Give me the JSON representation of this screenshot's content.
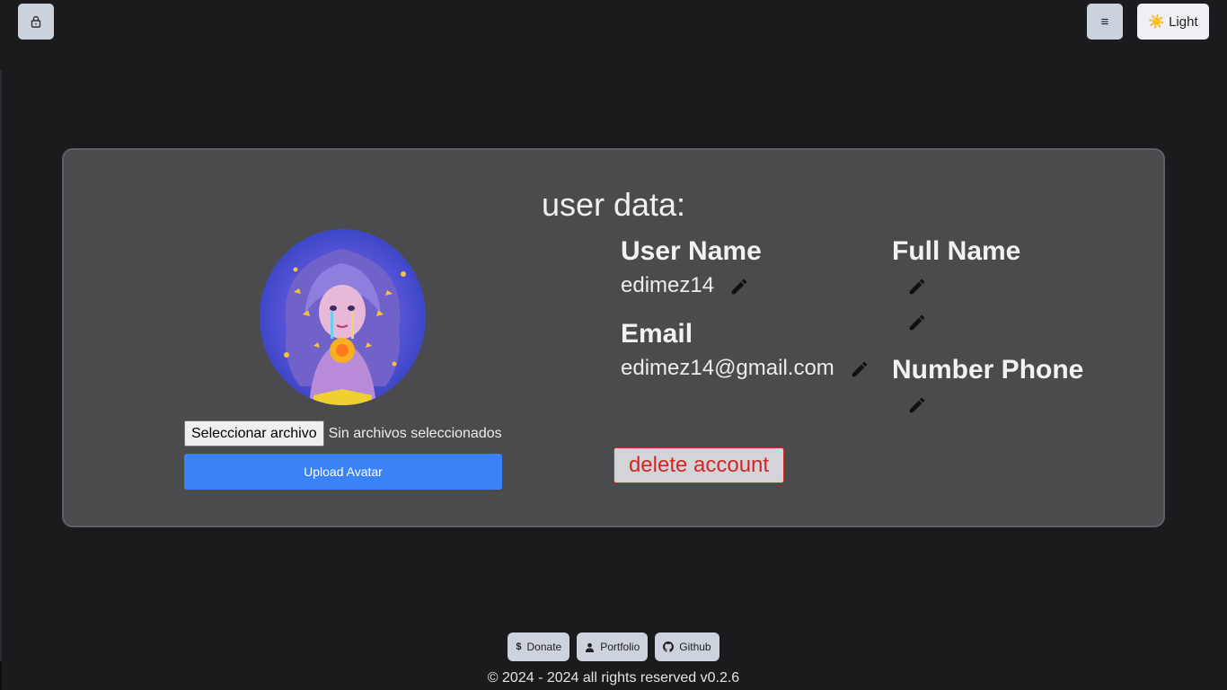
{
  "header": {
    "lock_icon": "lock-icon",
    "menu_label": "≡",
    "theme_icon": "☀️",
    "theme_label": "Light"
  },
  "profile": {
    "title": "user data:",
    "avatar_alt": "anime girl avatar",
    "file_button_label": "Seleccionar archivo",
    "file_status": "Sin archivos seleccionados",
    "upload_label": "Upload Avatar",
    "user_name_label": "User Name",
    "user_name_value": "edimez14",
    "email_label": "Email",
    "email_value": "edimez14@gmail.com",
    "full_name_label": "Full Name",
    "number_phone_label": "Number Phone",
    "delete_label": "delete account"
  },
  "footer": {
    "links": [
      {
        "label": "Donate",
        "icon": "dollar-icon"
      },
      {
        "label": "Portfolio",
        "icon": "user-icon"
      },
      {
        "label": "Github",
        "icon": "github-icon"
      }
    ],
    "copyright": "© 2024 - 2024 all rights reserved v0.2.6"
  }
}
